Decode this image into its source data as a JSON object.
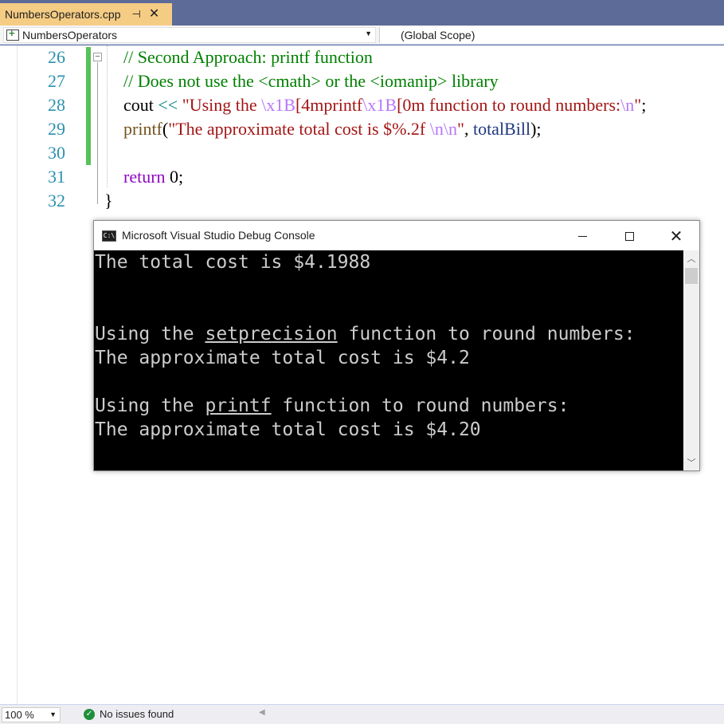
{
  "tab": {
    "title": "NumbersOperators.cpp",
    "pin": "⊣",
    "close": "✕"
  },
  "nav": {
    "project": "NumbersOperators",
    "scope": "(Global Scope)"
  },
  "editor": {
    "lines": [
      {
        "num": "26",
        "parts": [
          {
            "t": "// Second Approach: printf function",
            "c": "c-comment"
          }
        ]
      },
      {
        "num": "27",
        "parts": [
          {
            "t": "// Does not use the <cmath> or the <iomanip> library",
            "c": "c-comment"
          }
        ]
      },
      {
        "num": "28",
        "parts": [
          {
            "t": "cout ",
            "c": "c-plain"
          },
          {
            "t": "<<",
            "c": "c-op"
          },
          {
            "t": " \"Using the ",
            "c": "c-string"
          },
          {
            "t": "\\x1B",
            "c": "c-escape"
          },
          {
            "t": "[4mprintf",
            "c": "c-string"
          },
          {
            "t": "\\x1B",
            "c": "c-escape"
          },
          {
            "t": "[0m function to round numbers:",
            "c": "c-string"
          },
          {
            "t": "\\n",
            "c": "c-escape"
          },
          {
            "t": "\"",
            "c": "c-string"
          },
          {
            "t": ";",
            "c": "c-plain"
          }
        ]
      },
      {
        "num": "29",
        "parts": [
          {
            "t": "printf",
            "c": "c-func"
          },
          {
            "t": "(",
            "c": "c-plain"
          },
          {
            "t": "\"The approximate total cost is $%.2f ",
            "c": "c-string"
          },
          {
            "t": "\\n\\n",
            "c": "c-escape"
          },
          {
            "t": "\"",
            "c": "c-string"
          },
          {
            "t": ", ",
            "c": "c-plain"
          },
          {
            "t": "totalBill",
            "c": "c-var"
          },
          {
            "t": ");",
            "c": "c-plain"
          }
        ]
      },
      {
        "num": "30",
        "parts": []
      },
      {
        "num": "31",
        "parts": [
          {
            "t": "return",
            "c": "c-kw"
          },
          {
            "t": " 0;",
            "c": "c-plain"
          }
        ]
      },
      {
        "num": "32",
        "parts": []
      }
    ],
    "closing_brace": "}"
  },
  "console": {
    "title": "Microsoft Visual Studio Debug Console",
    "icon_text": "C:\\",
    "close_glyph": "✕",
    "lines": [
      {
        "segments": [
          {
            "t": "The total cost is $4.1988"
          }
        ]
      },
      {
        "segments": []
      },
      {
        "segments": []
      },
      {
        "segments": [
          {
            "t": "Using the "
          },
          {
            "t": "setprecision",
            "u": true
          },
          {
            "t": " function to round numbers:"
          }
        ]
      },
      {
        "segments": [
          {
            "t": "The approximate total cost is $4.2"
          }
        ]
      },
      {
        "segments": []
      },
      {
        "segments": [
          {
            "t": "Using the "
          },
          {
            "t": "printf",
            "u": true
          },
          {
            "t": " function to round numbers:"
          }
        ]
      },
      {
        "segments": [
          {
            "t": "The approximate total cost is $4.20"
          }
        ]
      }
    ]
  },
  "status": {
    "zoom": "100 %",
    "issues": "No issues found"
  },
  "colors": {
    "accent_tab": "#f5cc84",
    "frame": "#5d6b99",
    "change_bar": "#57c05a"
  },
  "icons": [
    "pin-icon",
    "close-icon",
    "project-icon",
    "chevron-down-icon",
    "collapse-icon",
    "console-app-icon",
    "minimize-icon",
    "maximize-icon",
    "check-circle-icon"
  ]
}
